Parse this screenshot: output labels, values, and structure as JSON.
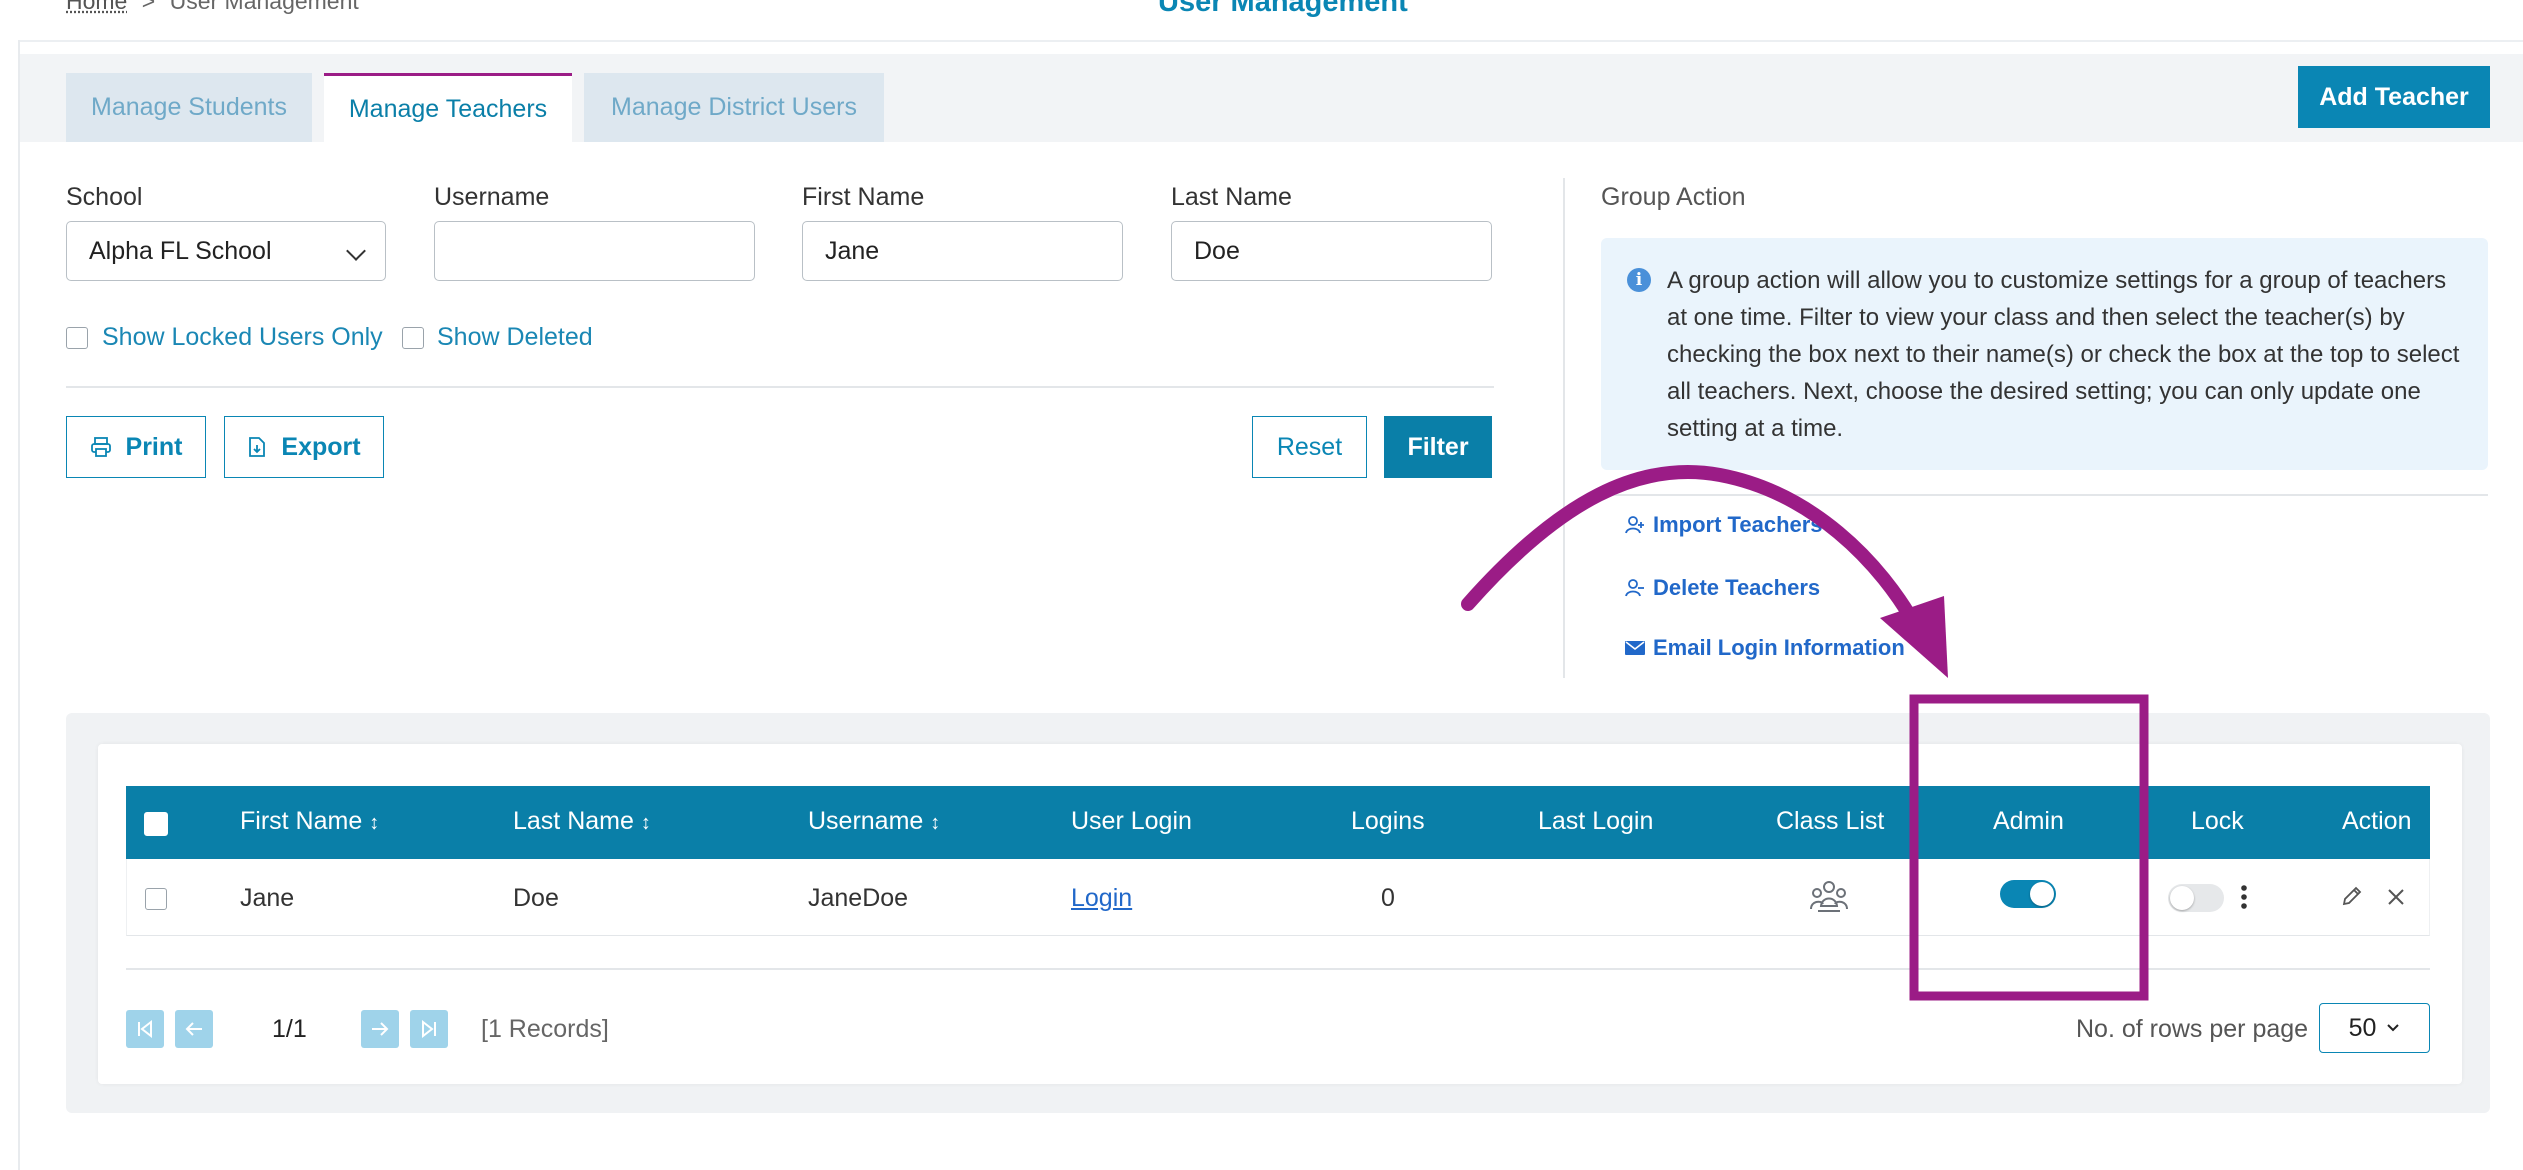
{
  "breadcrumb": {
    "home": "Home",
    "separator": ">",
    "current": "User Management"
  },
  "page_title": "User Management",
  "tabs": [
    {
      "label": "Manage Students",
      "active": false
    },
    {
      "label": "Manage Teachers",
      "active": true
    },
    {
      "label": "Manage District Users",
      "active": false
    }
  ],
  "add_button": "Add Teacher",
  "filters": {
    "school": {
      "label": "School",
      "value": "Alpha FL School"
    },
    "username": {
      "label": "Username",
      "value": ""
    },
    "first_name": {
      "label": "First Name",
      "value": "Jane"
    },
    "last_name": {
      "label": "Last Name",
      "value": "Doe"
    },
    "show_locked": "Show Locked Users Only",
    "show_deleted": "Show Deleted"
  },
  "buttons": {
    "print": "Print",
    "export": "Export",
    "reset": "Reset",
    "filter": "Filter"
  },
  "group_action": {
    "title": "Group Action",
    "info": "A group action will allow you to customize settings for a group of teachers at one time. Filter to view your class and then select the teacher(s) by checking the box next to their name(s) or check the box at the top to select all teachers. Next, choose the desired setting; you can only update one setting at a time.",
    "links": [
      "Import Teachers",
      "Delete Teachers",
      "Email Login Information"
    ]
  },
  "table": {
    "headers": {
      "first_name": "First Name",
      "last_name": "Last Name",
      "username": "Username",
      "user_login": "User Login",
      "logins": "Logins",
      "last_login": "Last Login",
      "class_list": "Class List",
      "admin": "Admin",
      "lock": "Lock",
      "action": "Action"
    },
    "sort_glyph": "↕",
    "rows": [
      {
        "first_name": "Jane",
        "last_name": "Doe",
        "username": "JaneDoe",
        "user_login": "Login",
        "logins": "0",
        "last_login": "",
        "admin": true,
        "lock": false
      }
    ]
  },
  "pagination": {
    "page": "1/1",
    "records": "[1 Records]",
    "rows_label": "No. of rows per page",
    "rows_value": "50"
  },
  "colors": {
    "primary": "#0a7fa8",
    "annotation": "#9b1c86",
    "link": "#2168c9"
  },
  "icons": [
    "chevron-down-icon",
    "print-icon",
    "export-icon",
    "info-icon",
    "user-plus-icon",
    "user-minus-icon",
    "mail-icon",
    "class-list-icon",
    "kebab-icon",
    "edit-icon",
    "delete-icon",
    "first-page-icon",
    "prev-page-icon",
    "next-page-icon",
    "last-page-icon"
  ]
}
